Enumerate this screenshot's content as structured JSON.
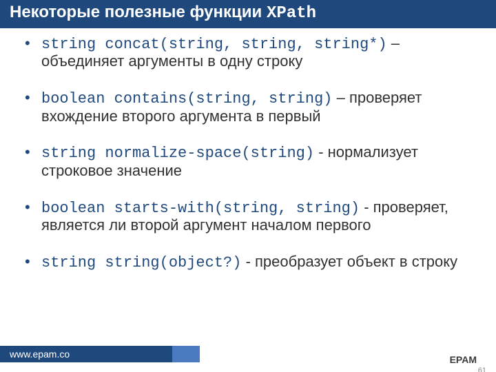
{
  "title": {
    "prefix": "Некоторые полезные функции ",
    "mono": "XPath"
  },
  "items": [
    {
      "sig": "string concat(string, string, string*)",
      "dash": " – ",
      "desc": "объединяет аргументы в одну строку"
    },
    {
      "sig": "boolean contains(string, string)",
      "dash": " – ",
      "desc": "проверяет вхождение второго аргумента в первый"
    },
    {
      "sig": "string normalize-space(string)",
      "dash": " - ",
      "desc": "нормализует строковое значение"
    },
    {
      "sig": "boolean starts-with(string, string)",
      "dash": " - ",
      "desc": "проверяет, является ли второй аргумент началом первого"
    },
    {
      "sig": "string string(object?)",
      "dash": " - ",
      "desc": "преобразует объект в строку"
    }
  ],
  "footer": {
    "left": "www.epam.co",
    "right_top": "EPAM"
  },
  "page": "61"
}
